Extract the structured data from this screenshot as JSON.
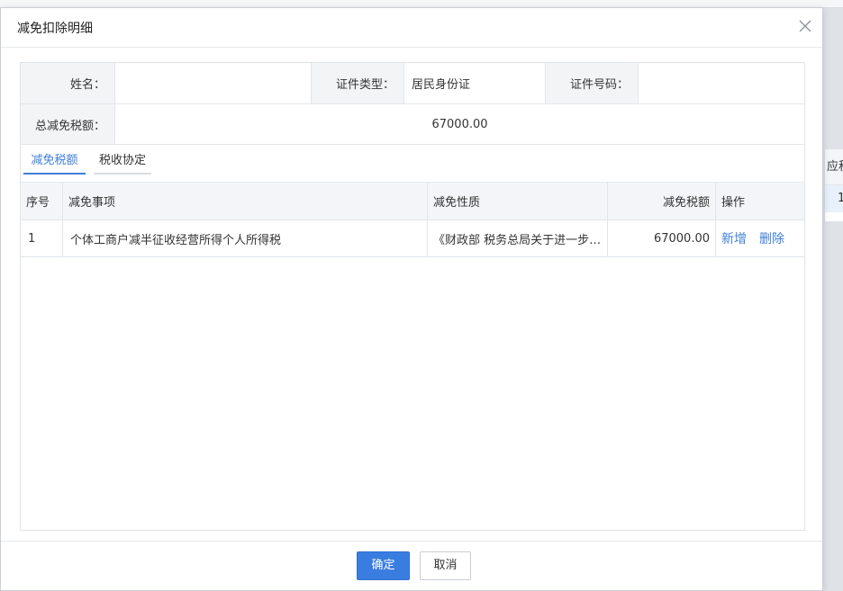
{
  "background": {
    "right_header": "应税",
    "right_row": "1"
  },
  "dialog": {
    "title": "减免扣除明细"
  },
  "info": {
    "name_label": "姓名：",
    "name_value": "",
    "id_type_label": "证件类型：",
    "id_type_value": "居民身份证",
    "id_no_label": "证件号码：",
    "id_no_value": "",
    "total_label": "总减免税额：",
    "total_value": "67000.00"
  },
  "tabs": [
    {
      "label": "减免税额",
      "active": true
    },
    {
      "label": "税收协定",
      "active": false
    }
  ],
  "grid": {
    "columns": [
      "序号",
      "减免事项",
      "减免性质",
      "减免税额",
      "操作"
    ],
    "rows": [
      {
        "index": "1",
        "item": "个体工商户减半征收经营所得个人所得税",
        "nature": "《财政部 税务总局关于进一步支持小微企业和个体工商户发展有关税费政策的公告》",
        "amount": "67000.00",
        "actions": [
          "新增",
          "删除"
        ]
      }
    ]
  },
  "footer": {
    "confirm": "确定",
    "cancel": "取消"
  },
  "colors": {
    "primary": "#3a7de0",
    "link": "#3f7fd9"
  }
}
